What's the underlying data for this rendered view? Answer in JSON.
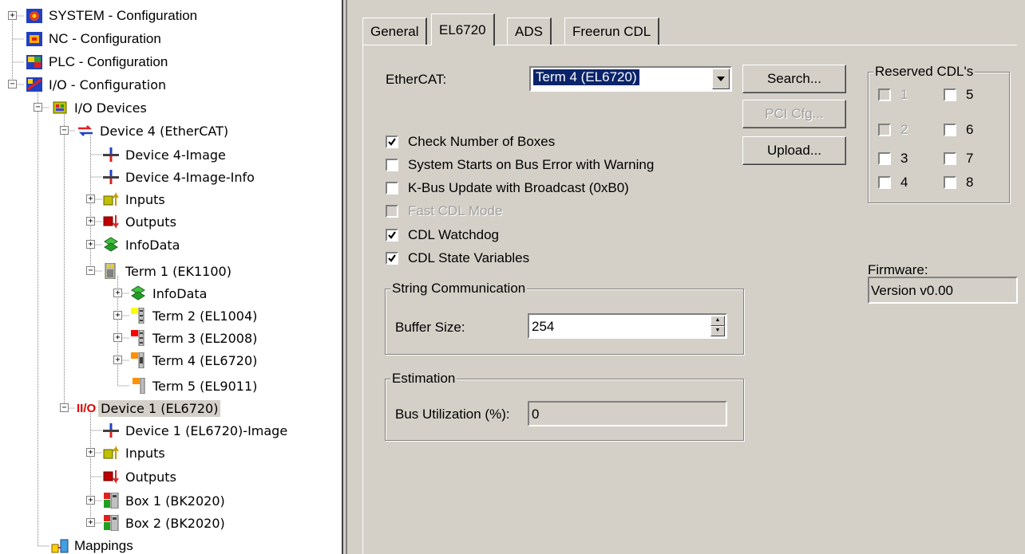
{
  "tree": {
    "system": "SYSTEM - Configuration",
    "nc": "NC - Configuration",
    "plc": "PLC - Configuration",
    "io": "I/O - Configuration",
    "io_devices": "I/O Devices",
    "device4": "Device 4 (EtherCAT)",
    "device4_image": "Device 4-Image",
    "device4_image_info": "Device 4-Image-Info",
    "inputs": "Inputs",
    "outputs": "Outputs",
    "infodata": "InfoData",
    "term1": "Term 1 (EK1100)",
    "term1_infodata": "InfoData",
    "term2": "Term 2 (EL1004)",
    "term3": "Term 3 (EL2008)",
    "term4": "Term 4 (EL6720)",
    "term5": "Term 5 (EL9011)",
    "device1_prefix": "II/O",
    "device1": "Device 1 (EL6720)",
    "device1_image": "Device 1 (EL6720)-Image",
    "device1_inputs": "Inputs",
    "device1_outputs": "Outputs",
    "box1": "Box 1 (BK2020)",
    "box2": "Box 2 (BK2020)",
    "mappings": "Mappings"
  },
  "tabs": [
    "General",
    "EL6720",
    "ADS",
    "Freerun CDL"
  ],
  "active_tab": "EL6720",
  "form": {
    "ethercat_label": "EtherCAT:",
    "ethercat_value": "Term 4 (EL6720)",
    "search_button": "Search...",
    "pci_cfg_button": "PCI Cfg...",
    "upload_button": "Upload...",
    "check_boxes": [
      {
        "label": "Check Number of Boxes",
        "checked": true,
        "enabled": true
      },
      {
        "label": "System Starts on Bus Error with Warning",
        "checked": false,
        "enabled": true
      },
      {
        "label": "K-Bus Update with Broadcast (0xB0)",
        "checked": false,
        "enabled": true
      },
      {
        "label": "Fast CDL Mode",
        "checked": false,
        "enabled": false
      },
      {
        "label": "CDL Watchdog",
        "checked": true,
        "enabled": true
      },
      {
        "label": "CDL State Variables",
        "checked": true,
        "enabled": true
      }
    ],
    "string_comm_title": "String Communication",
    "buffer_size_label": "Buffer Size:",
    "buffer_size_value": "254",
    "estimation_title": "Estimation",
    "bus_util_label": "Bus Utilization (%):",
    "bus_util_value": "0",
    "reserved_title": "Reserved CDL's",
    "reserved": [
      {
        "label": "1",
        "enabled": false
      },
      {
        "label": "5",
        "enabled": true
      },
      {
        "label": "2",
        "enabled": false
      },
      {
        "label": "6",
        "enabled": true
      },
      {
        "label": "3",
        "enabled": true
      },
      {
        "label": "7",
        "enabled": true
      },
      {
        "label": "4",
        "enabled": true
      },
      {
        "label": "8",
        "enabled": true
      }
    ],
    "firmware_label": "Firmware:",
    "firmware_value": "Version v0.00"
  },
  "colors": {
    "panel_bg": "#d4d0c8",
    "selection": "#0a246a"
  }
}
